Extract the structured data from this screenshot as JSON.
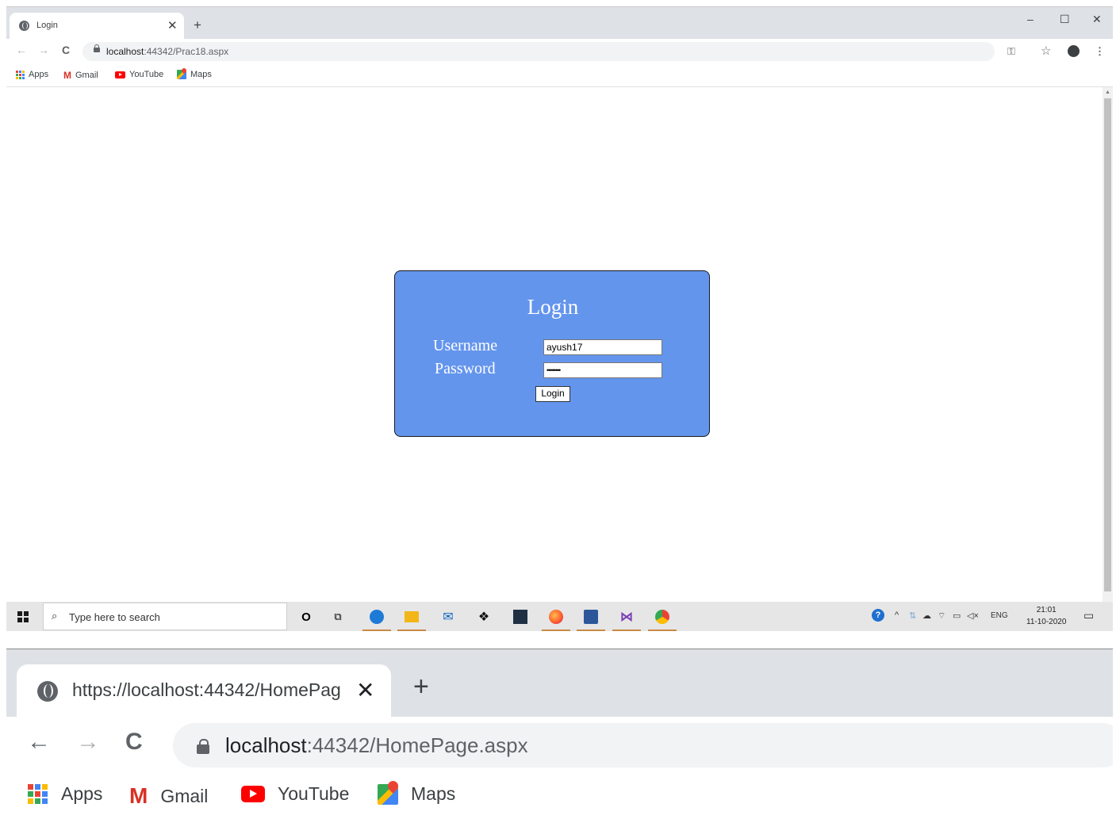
{
  "top": {
    "tab": {
      "title": "Login"
    },
    "new_tab": "+",
    "window_controls": {
      "minimize": "–",
      "maximize": "☐",
      "close": "✕"
    },
    "nav": {
      "back": "←",
      "forward": "→",
      "reload": "C"
    },
    "address": {
      "host": "localhost",
      "path": ":44342/Prac18.aspx"
    },
    "bookmarks": {
      "apps": "Apps",
      "gmail": "Gmail",
      "youtube": "YouTube",
      "maps": "Maps"
    },
    "login": {
      "title": "Login",
      "username_label": "Username",
      "password_label": "Password",
      "username_value": "ayush17",
      "password_masked": "••••••••",
      "button": "Login"
    },
    "taskbar": {
      "search_placeholder": "Type here to search",
      "lang": "ENG",
      "time": "21:01",
      "date": "11-10-2020"
    }
  },
  "bottom": {
    "tab": {
      "title": "https://localhost:44342/HomePag"
    },
    "new_tab": "+",
    "nav": {
      "back": "←",
      "forward": "→",
      "reload": "C"
    },
    "address": {
      "host": "localhost",
      "path": ":44342/HomePage.aspx"
    },
    "bookmarks": {
      "apps": "Apps",
      "gmail": "Gmail",
      "youtube": "YouTube",
      "maps": "Maps"
    }
  },
  "colors": {
    "panel_bg": "#6495ed",
    "tabstrip": "#dee1e6",
    "omnibox": "#f1f3f4",
    "taskbar": "#e6e6e6"
  }
}
